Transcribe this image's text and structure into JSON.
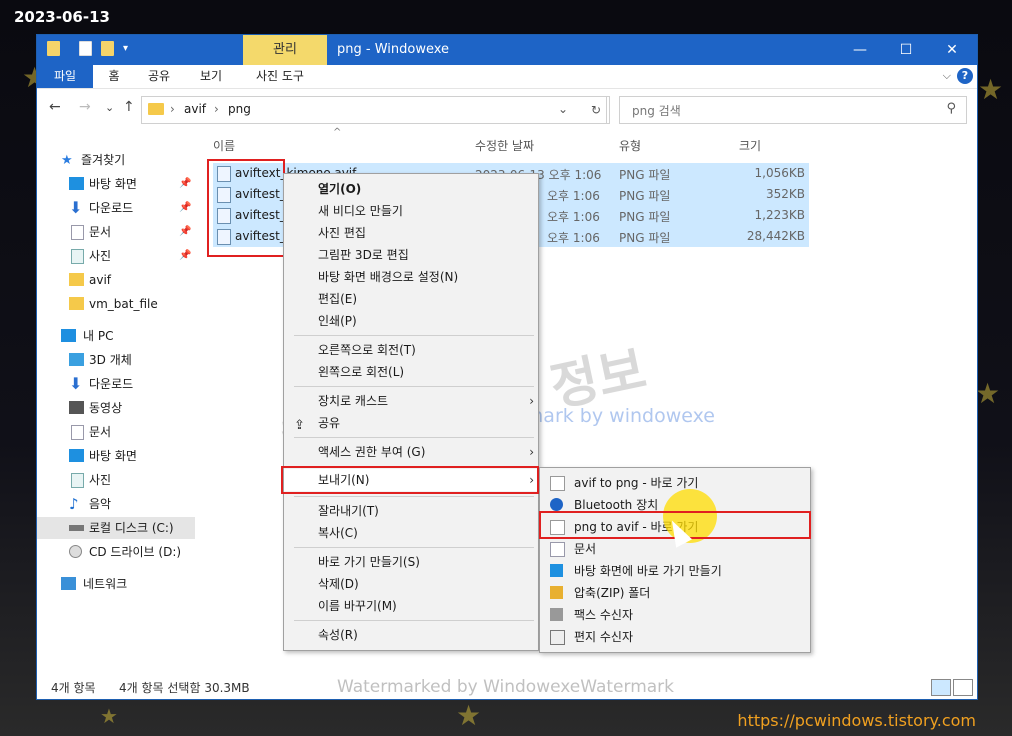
{
  "overlay": {
    "date": "2023-06-13",
    "site_url": "https://pcwindows.tistory.com"
  },
  "window": {
    "title_tab": "관리",
    "title": "png   - Windowexe",
    "controls": {
      "minimize": "—",
      "maximize": "☐",
      "close": "✕"
    }
  },
  "ribbon": {
    "tabs": [
      "파일",
      "홈",
      "공유",
      "보기",
      "사진 도구"
    ],
    "collapse": "⌵",
    "help": "?"
  },
  "nav": {
    "back": "←",
    "forward": "→",
    "history": "⌄",
    "up": "↑",
    "path": [
      "avif",
      "png"
    ],
    "path_sep": "›",
    "dropdown": "⌄",
    "refresh": "↻",
    "search_placeholder": "png 검색",
    "search_icon": "⚲"
  },
  "sidebar": {
    "items": [
      {
        "label": "즐겨찾기",
        "icon": "star-icon",
        "color": "#2b7de0"
      },
      {
        "label": "바탕 화면",
        "icon": "desktop-icon",
        "pinned": true,
        "color": "#1e90e0"
      },
      {
        "label": "다운로드",
        "icon": "download-icon",
        "pinned": true,
        "color": "#2a6fd0"
      },
      {
        "label": "문서",
        "icon": "document-icon",
        "pinned": true,
        "color": "#9ab"
      },
      {
        "label": "사진",
        "icon": "pictures-icon",
        "pinned": true,
        "color": "#7aa"
      },
      {
        "label": "avif",
        "icon": "folder-icon",
        "color": "#f5c94a"
      },
      {
        "label": "vm_bat_file",
        "icon": "folder-icon",
        "color": "#f5c94a"
      },
      {
        "label": "내 PC",
        "icon": "pc-icon",
        "color": "#1e8fe0"
      },
      {
        "label": "3D 개체",
        "icon": "cube-icon",
        "color": "#3aa0e0"
      },
      {
        "label": "다운로드",
        "icon": "download-icon",
        "color": "#2a6fd0"
      },
      {
        "label": "동영상",
        "icon": "video-icon",
        "color": "#555"
      },
      {
        "label": "문서",
        "icon": "document-icon",
        "color": "#9ab"
      },
      {
        "label": "바탕 화면",
        "icon": "desktop-icon",
        "color": "#1e90e0"
      },
      {
        "label": "사진",
        "icon": "pictures-icon",
        "color": "#7aa"
      },
      {
        "label": "음악",
        "icon": "music-icon",
        "color": "#1e6fd0"
      },
      {
        "label": "로컬 디스크 (C:)",
        "icon": "disk-icon",
        "selected": true,
        "color": "#777"
      },
      {
        "label": "CD 드라이브 (D:)",
        "icon": "cd-icon",
        "color": "#888"
      },
      {
        "label": "네트워크",
        "icon": "network-icon",
        "color": "#3a90d8"
      }
    ],
    "pin_glyph": "📌"
  },
  "file_list": {
    "columns": [
      "이름",
      "수정한 날짜",
      "유형",
      "크기"
    ],
    "sort_indicator": "^",
    "rows": [
      {
        "name": "aviftext_kimono.avif",
        "date": "2023-06-13 오후 1:06",
        "type": "PNG 파일",
        "size": "1,056KB"
      },
      {
        "name": "aviftest_A",
        "date": "오후 1:06",
        "type": "PNG 파일",
        "size": "352KB"
      },
      {
        "name": "aviftest_f",
        "date": "오후 1:06",
        "type": "PNG 파일",
        "size": "1,223KB"
      },
      {
        "name": "aviftest_h",
        "date": "오후 1:06",
        "type": "PNG 파일",
        "size": "28,442KB"
      }
    ]
  },
  "context_menu": {
    "items": [
      {
        "label": "열기(O)",
        "bold": true
      },
      {
        "label": "새 비디오 만들기"
      },
      {
        "label": "사진 편집"
      },
      {
        "label": "그림판 3D로 편집"
      },
      {
        "label": "바탕 화면 배경으로 설정(N)"
      },
      {
        "label": "편집(E)"
      },
      {
        "label": "인쇄(P)"
      },
      {
        "label": "오른쪽으로 회전(T)"
      },
      {
        "label": "왼쪽으로 회전(L)"
      },
      {
        "label": "장치로 캐스트",
        "submenu": true
      },
      {
        "label": "공유",
        "icon": "share-icon"
      },
      {
        "label": "액세스 권한 부여 (G)",
        "submenu": true
      },
      {
        "label": "보내기(N)",
        "submenu": true
      },
      {
        "label": "잘라내기(T)"
      },
      {
        "label": "복사(C)"
      },
      {
        "label": "바로 가기 만들기(S)"
      },
      {
        "label": "삭제(D)"
      },
      {
        "label": "이름 바꾸기(M)"
      },
      {
        "label": "속성(R)"
      }
    ],
    "arrow": "›"
  },
  "send_to_menu": {
    "items": [
      {
        "label": "avif to png - 바로 가기",
        "icon": "shortcut-icon"
      },
      {
        "label": "Bluetooth 장치",
        "icon": "bluetooth-icon"
      },
      {
        "label": "png to avif - 바로 가기",
        "icon": "shortcut-icon"
      },
      {
        "label": "문서",
        "icon": "document-icon"
      },
      {
        "label": "바탕 화면에 바로 가기 만들기",
        "icon": "desktop-icon"
      },
      {
        "label": "압축(ZIP) 폴더",
        "icon": "zip-icon"
      },
      {
        "label": "팩스 수신자",
        "icon": "fax-icon"
      },
      {
        "label": "편지 수신자",
        "icon": "mail-icon"
      }
    ]
  },
  "watermarks": {
    "big": "컴퓨터 관련 정보",
    "small": "watermark by windowexe",
    "bottom": "Watermarked by WindowexeWatermark"
  },
  "status": {
    "count": "4개 항목",
    "selection": "4개 항목 선택함 30.3MB"
  },
  "colors": {
    "accent": "#1e64c6",
    "selection": "#cce8ff",
    "highlight_box": "#e02020",
    "context_tab": "#f4d96b"
  }
}
